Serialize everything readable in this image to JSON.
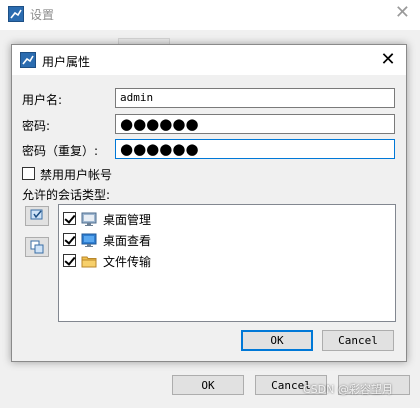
{
  "background_window": {
    "title": "设置",
    "buttons": {
      "ok": "OK",
      "cancel": "Cancel",
      "apply": "?"
    },
    "watermark": "CSDN @彩容望月"
  },
  "dialog": {
    "title": "用户属性",
    "close_label": "✕",
    "fields": {
      "username_label": "用户名:",
      "username_value": "admin",
      "password_label": "密码:",
      "password_value": "●●●●●●",
      "password_confirm_label": "密码（重复）:",
      "password_confirm_value": "●●●●●●"
    },
    "disable_account": {
      "label": "禁用用户帐号",
      "checked": false
    },
    "session_types_label": "允许的会话类型:",
    "session_types": [
      {
        "label": "桌面管理",
        "checked": true,
        "icon": "desktop-manage-icon"
      },
      {
        "label": "桌面查看",
        "checked": true,
        "icon": "desktop-view-icon"
      },
      {
        "label": "文件传输",
        "checked": true,
        "icon": "file-transfer-icon"
      }
    ],
    "buttons": {
      "ok": "OK",
      "cancel": "Cancel"
    }
  },
  "colors": {
    "accent": "#0078d7",
    "dialog_bg": "#f0f0f0",
    "button_bg": "#e1e1e1"
  }
}
